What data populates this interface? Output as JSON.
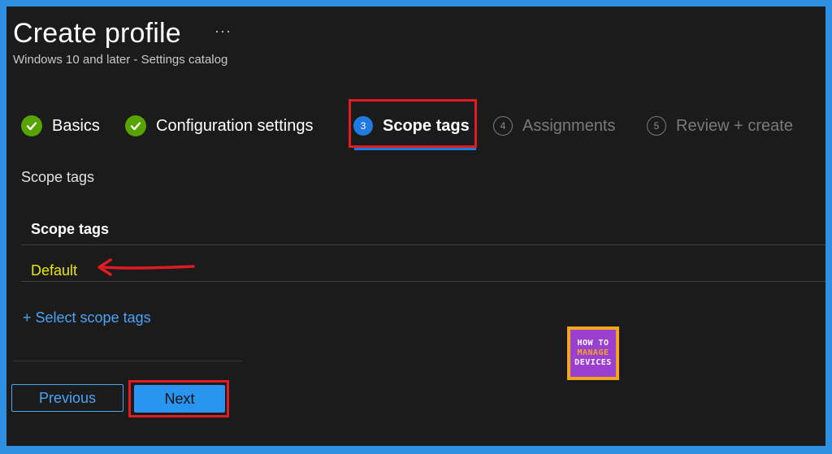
{
  "header": {
    "title": "Create profile",
    "more": "···",
    "subtitle": "Windows 10 and later - Settings catalog"
  },
  "steps": [
    {
      "label": "Basics",
      "state": "complete"
    },
    {
      "label": "Configuration settings",
      "state": "complete"
    },
    {
      "label": "Scope tags",
      "number": "3",
      "state": "active"
    },
    {
      "label": "Assignments",
      "number": "4",
      "state": "pending"
    },
    {
      "label": "Review + create",
      "number": "5",
      "state": "pending"
    }
  ],
  "section": {
    "label": "Scope tags",
    "table": {
      "header": "Scope tags",
      "rows": [
        "Default"
      ]
    },
    "link": "+ Select scope tags"
  },
  "footer": {
    "previous_label": "Previous",
    "next_label": "Next"
  },
  "logo": {
    "line1": "HOW TO",
    "line2": "MANAGE",
    "line3": "DEVICES"
  },
  "colors": {
    "background": "#1b1b1b",
    "accent": "#2a95f0",
    "complete": "#57a300",
    "highlight": "#e11b22",
    "default_text": "#e8e800"
  }
}
